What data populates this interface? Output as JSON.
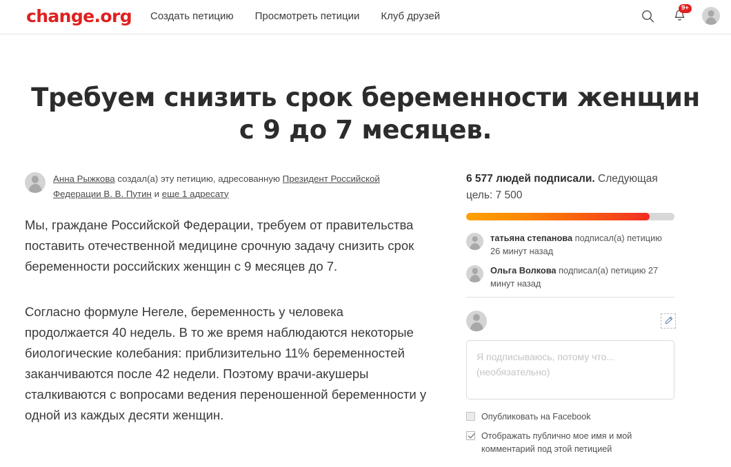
{
  "header": {
    "logo": "change.org",
    "nav": [
      {
        "label": "Создать петицию",
        "name": "nav-create-petition"
      },
      {
        "label": "Просмотреть петиции",
        "name": "nav-browse-petitions"
      },
      {
        "label": "Клуб друзей",
        "name": "nav-friends-club"
      }
    ],
    "search_icon": "search-icon",
    "bell_icon": "bell-icon",
    "notification_badge": "9+",
    "avatar_icon": "user-avatar"
  },
  "petition": {
    "title": "Требуем снизить срок беременности женщин с 9 до 7 месяцев.",
    "byline": {
      "author": "Анна Рыжкова",
      "created_text": "создал(а) эту петицию, адресованную",
      "recipient": "Президент Российской Федерации В. В. Путин",
      "and_text": "и",
      "more_recipients": "еще 1 адресату"
    },
    "paragraphs": [
      "Мы, граждане Российской Федерации, требуем от правительства поставить отечественной медицине срочную задачу снизить срок беременности российских женщин с 9 месяцев до 7.",
      "Согласно формуле Негеле, беременность у человека продолжается 40 недель. В то же время наблюдаются некоторые биологические колебания: приблизительно 11% беременностей заканчиваются после 42 недели. Поэтому врачи-акушеры сталкиваются с вопросами ведения переношенной беременности у одной из каждых десяти женщин."
    ]
  },
  "sidebar": {
    "signed_count": "6 577 людей подписали.",
    "goal_text": "Следующая цель: 7 500",
    "progress": {
      "current": 6577,
      "goal": 7500,
      "percent": 88,
      "fill_start_color": "#ffa100",
      "fill_end_color": "#f22a22",
      "track_color": "#d8d8d8"
    },
    "signers": [
      {
        "name": "татьяна степанова",
        "action": "подписал(а) петицию 26 минут назад"
      },
      {
        "name": "Ольга Волкова",
        "action": "подписал(а) петицию 27 минут назад"
      }
    ],
    "composer": {
      "avatar_icon": "user-avatar",
      "edit_icon": "pencil-icon",
      "placeholder_line1": "Я подписываюсь, потому что...",
      "placeholder_line2": "(необязательно)",
      "value": ""
    },
    "checkboxes": [
      {
        "label": "Опубликовать на Facebook",
        "checked": false,
        "name": "checkbox-publish-facebook"
      },
      {
        "label": "Отображать публично мое имя и мой комментарий под этой петицией",
        "checked": true,
        "name": "checkbox-display-publicly"
      }
    ]
  },
  "colors": {
    "brand_red": "#e02020",
    "text_dark": "#2c2c2c",
    "text_body": "#3a3a3a",
    "border": "#e3e3e3"
  }
}
